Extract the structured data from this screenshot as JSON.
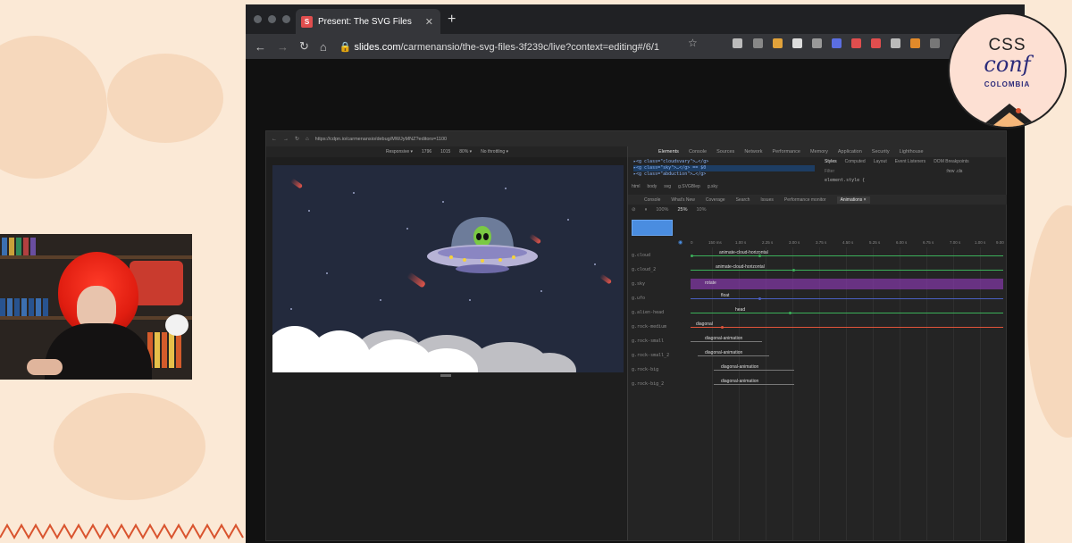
{
  "browser": {
    "tab_title": "Present: The SVG Files",
    "tab_favicon_letter": "S",
    "url_domain": "slides.com",
    "url_path": "/carmenansio/the-svg-files-3f239c/live?context=editing#/6/1"
  },
  "inner_browser": {
    "url": "https://cdpn.io/carmenansio/debug/MWJyMNZ?editors=1100",
    "device": "Responsive ▾",
    "width": "1796",
    "height": "1015",
    "zoom": "80% ▾",
    "throttle": "No throttling ▾"
  },
  "devtools": {
    "tabs": [
      "Elements",
      "Console",
      "Sources",
      "Network",
      "Performance",
      "Memory",
      "Application",
      "Security",
      "Lighthouse"
    ],
    "code_lines": [
      "▸<g class=\"cloudsvary\">…</g>",
      "▸<g class=\"sky\">…</g> == $0",
      "▸<g class=\"abduction\">…</g>"
    ],
    "styles_tabs": [
      "Styles",
      "Computed",
      "Layout",
      "Event Listeners",
      "DOM Breakpoints"
    ],
    "filter_placeholder": "Filter",
    "filter_hints": ":hov .cls",
    "element_style": "element.style {",
    "breadcrumbs": [
      "html",
      "body",
      "svg",
      "g.SVGBlep",
      "g.sky"
    ],
    "drawer_tabs": [
      "Console",
      "What's New",
      "Coverage",
      "Search",
      "Issues",
      "Performance monitor",
      "Animations ×"
    ],
    "speeds": [
      "100%",
      "25%",
      "10%"
    ],
    "ticks": [
      "0",
      "150 ms",
      "1.00 s",
      "2.25 s",
      "3.00 s",
      "3.75 s",
      "4.50 s",
      "5.25 s",
      "6.00 s",
      "6.75 s",
      "7.00 s",
      "1.00 s",
      "9.00"
    ],
    "tracks": [
      {
        "label": "g.cloud",
        "name": "animate-cloud-horizontal",
        "color": "#3bb15a"
      },
      {
        "label": "g.cloud_2",
        "name": "animate-cloud-horizontal",
        "color": "#3bb15a"
      },
      {
        "label": "g.sky",
        "name": "rotate",
        "color": "#8e3ab5"
      },
      {
        "label": "g.ufo",
        "name": "float",
        "color": "#4a5fc1"
      },
      {
        "label": "g.alien-head",
        "name": "head",
        "color": "#3bb15a"
      },
      {
        "label": "g.rock-medium",
        "name": "diagonal",
        "color": "#e0533a"
      },
      {
        "label": "g.rock-small",
        "name": "diagonal-animation",
        "color": "#777777"
      },
      {
        "label": "g.rock-small_2",
        "name": "diagonal-animation",
        "color": "#777777"
      },
      {
        "label": "g.rock-big",
        "name": "diagonal-animation",
        "color": "#777777"
      },
      {
        "label": "g.rock-big_2",
        "name": "diagonal-animation",
        "color": "#777777"
      }
    ]
  },
  "logo": {
    "line1": "CSS",
    "line2": "conf",
    "line3": "COLOMBIA"
  }
}
